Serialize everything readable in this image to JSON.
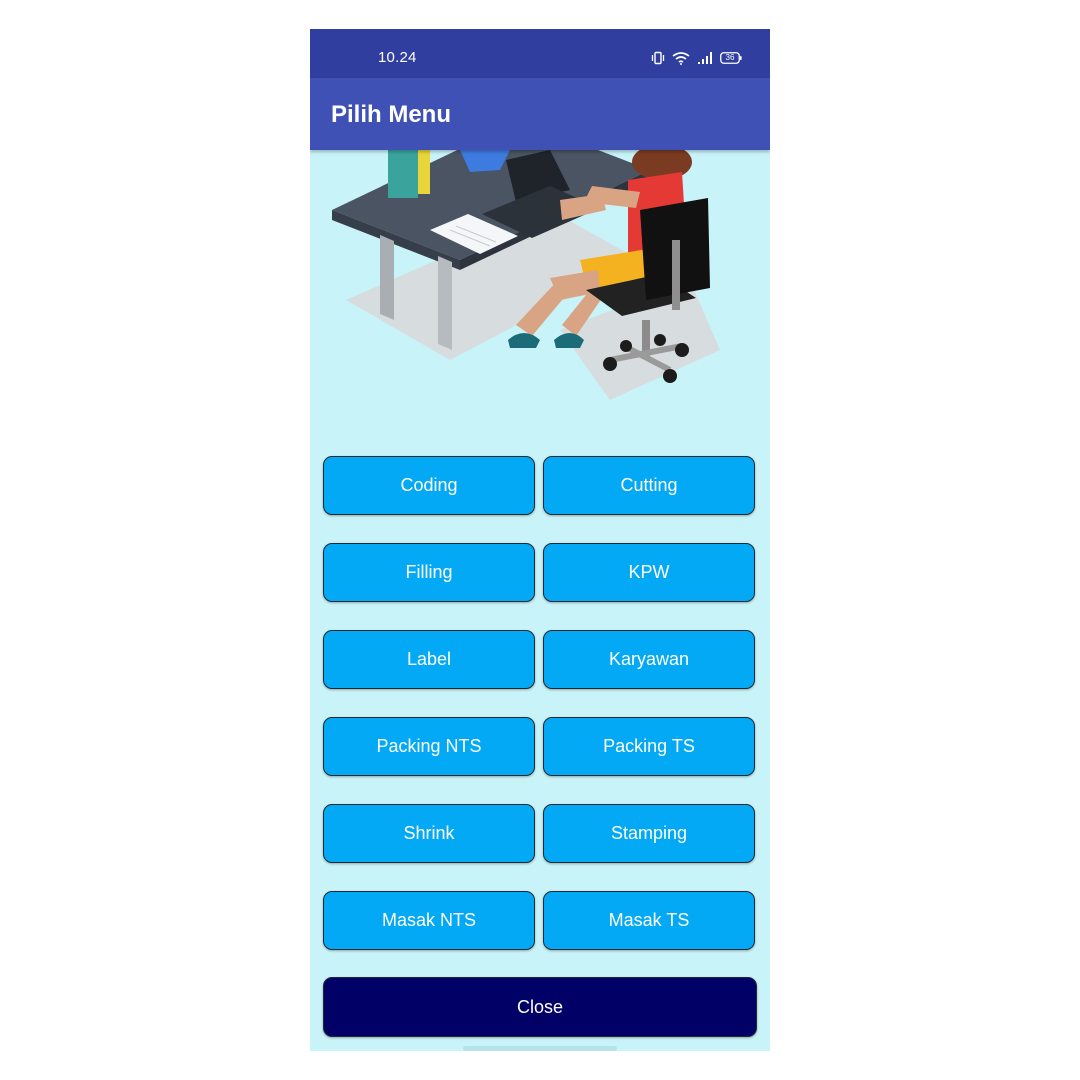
{
  "status_bar": {
    "time": "10.24",
    "battery": "36",
    "icons": [
      "vibrate-icon",
      "wifi-icon",
      "signal-icon",
      "battery-icon"
    ]
  },
  "app_bar": {
    "title": "Pilih Menu"
  },
  "illustration": {
    "icon": "office-worker-illustration"
  },
  "menu": {
    "buttons": [
      {
        "label": "Coding"
      },
      {
        "label": "Cutting"
      },
      {
        "label": "Filling"
      },
      {
        "label": "KPW"
      },
      {
        "label": "Label"
      },
      {
        "label": "Karyawan"
      },
      {
        "label": "Packing NTS"
      },
      {
        "label": "Packing TS"
      },
      {
        "label": "Shrink"
      },
      {
        "label": "Stamping"
      },
      {
        "label": "Masak NTS"
      },
      {
        "label": "Masak TS"
      }
    ],
    "close_label": "Close"
  },
  "colors": {
    "status_bar": "#303f9f",
    "app_bar": "#3f51b5",
    "background": "#c8f3f8",
    "menu_button": "#03a9f4",
    "close_button": "#000066"
  }
}
